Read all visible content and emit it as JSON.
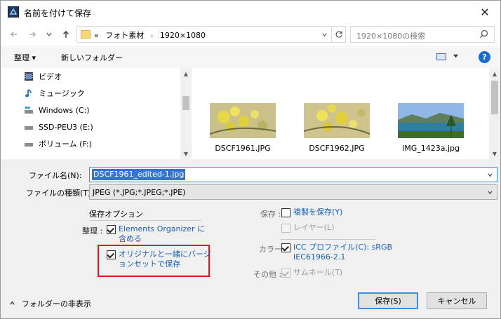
{
  "window": {
    "title": "名前を付けて保存",
    "close_glyph": "✕"
  },
  "address_bar": {
    "crumb_prefix": "«",
    "crumbs": [
      "フォト素材",
      "1920×1080"
    ],
    "separator": "›"
  },
  "search": {
    "placeholder": "1920×1080の検索"
  },
  "toolbar": {
    "organize": "整理 ▾",
    "new_folder": "新しいフォルダー",
    "help": "?"
  },
  "tree": {
    "items": [
      {
        "label": "ビデオ",
        "icon": "video-icon"
      },
      {
        "label": "ミュージック",
        "icon": "music-icon"
      },
      {
        "label": "Windows (C:)",
        "icon": "drive-icon"
      },
      {
        "label": "SSD-PEU3 (E:)",
        "icon": "drive-icon"
      },
      {
        "label": "ボリューム (F:)",
        "icon": "drive-icon"
      }
    ]
  },
  "files": [
    {
      "name": "DSCF1961.JPG",
      "thumb": "yellow-flowers"
    },
    {
      "name": "DSCF1962.JPG",
      "thumb": "yellow-flowers"
    },
    {
      "name": "IMG_1423a.jpg",
      "thumb": "lake-landscape"
    }
  ],
  "filename": {
    "label": "ファイル名(N):",
    "value": "DSCF1961_edited-1.jpg"
  },
  "filetype": {
    "label": "ファイルの種類(T):",
    "value": "JPEG (*.JPG;*.JPEG;*.JPE)"
  },
  "options": {
    "heading": "保存オプション",
    "organize_label": "整理 :",
    "elements_organizer_line1": "Elements Organizer に",
    "elements_organizer_line2": "含める",
    "version_set_line1": "オリジナルと一緒にバージ",
    "version_set_line2": "ョンセットで保存",
    "save_label": "保存 :",
    "copy_save": "複製を保存(Y)",
    "layers": "レイヤー(L)",
    "color_label": "カラー :",
    "icc_line1": "ICC プロファイル(C): sRGB",
    "icc_line2": "IEC61966-2.1",
    "other_label": "その他 :",
    "thumbnail": "サムネール(T)"
  },
  "footer": {
    "hide_folders": "フォルダーの非表示",
    "save_button": "保存(S)",
    "cancel_button": "キャンセル"
  },
  "colors": {
    "accent": "#3574d5",
    "link": "#1a5fb4",
    "highlight": "#e0161b"
  }
}
